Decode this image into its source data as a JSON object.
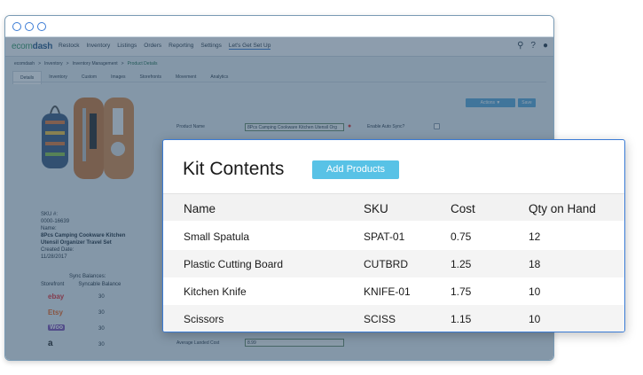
{
  "app": {
    "logo": {
      "prefix": "ecom",
      "suffix": "dash"
    },
    "nav": [
      "Restock",
      "Inventory",
      "Listings",
      "Orders",
      "Reporting",
      "Settings",
      "Let's Get Set Up"
    ],
    "breadcrumb": [
      "ecomdash",
      ">",
      "Inventory",
      ">",
      "Inventory Management",
      ">",
      "Product Details"
    ],
    "tabs": [
      "Details",
      "Inventory",
      "Custom",
      "Images",
      "Storefronts",
      "Movement",
      "Analytics"
    ],
    "actions_label": "Actions ▼",
    "save_label": "Save"
  },
  "product": {
    "sku_label": "SKU #:",
    "sku": "0000-16639",
    "name_label": "Name:",
    "name_line1": "8Pcs Camping Cookware Kitchen",
    "name_line2": "Utensil Organizer Travel Set",
    "created_label": "Created Date:",
    "created": "11/28/2017",
    "product_name_label": "Product Name",
    "product_name_value": "8Pcs Camping Cookware Kitchen Utensil Org",
    "auto_sync_label": "Enable Auto Sync?",
    "avg_cost_label": "Average Landed Cost",
    "avg_cost_value": "8.99"
  },
  "sync": {
    "title": "Sync Balances:",
    "col_storefront": "Storefront",
    "col_balance": "Syncable Balance",
    "stores": [
      {
        "name": "ebay",
        "color": "#e53238",
        "balance": "30"
      },
      {
        "name": "Etsy",
        "color": "#f1641e",
        "balance": "30"
      },
      {
        "name": "Woo",
        "color": "#7f54b3",
        "balance": "30"
      },
      {
        "name": "a",
        "color": "#222222",
        "balance": "30"
      }
    ]
  },
  "kit": {
    "title": "Kit Contents",
    "add_label": "Add Products",
    "columns": [
      "Name",
      "SKU",
      "Cost",
      "Qty on Hand"
    ],
    "rows": [
      {
        "name": "Small Spatula",
        "sku": "SPAT-01",
        "cost": "0.75",
        "qty": "12"
      },
      {
        "name": "Plastic Cutting Board",
        "sku": "CUTBRD",
        "cost": "1.25",
        "qty": "18"
      },
      {
        "name": "Kitchen Knife",
        "sku": "KNIFE-01",
        "cost": "1.75",
        "qty": "10"
      },
      {
        "name": "Scissors",
        "sku": "SCISS",
        "cost": "1.15",
        "qty": "10"
      }
    ]
  }
}
